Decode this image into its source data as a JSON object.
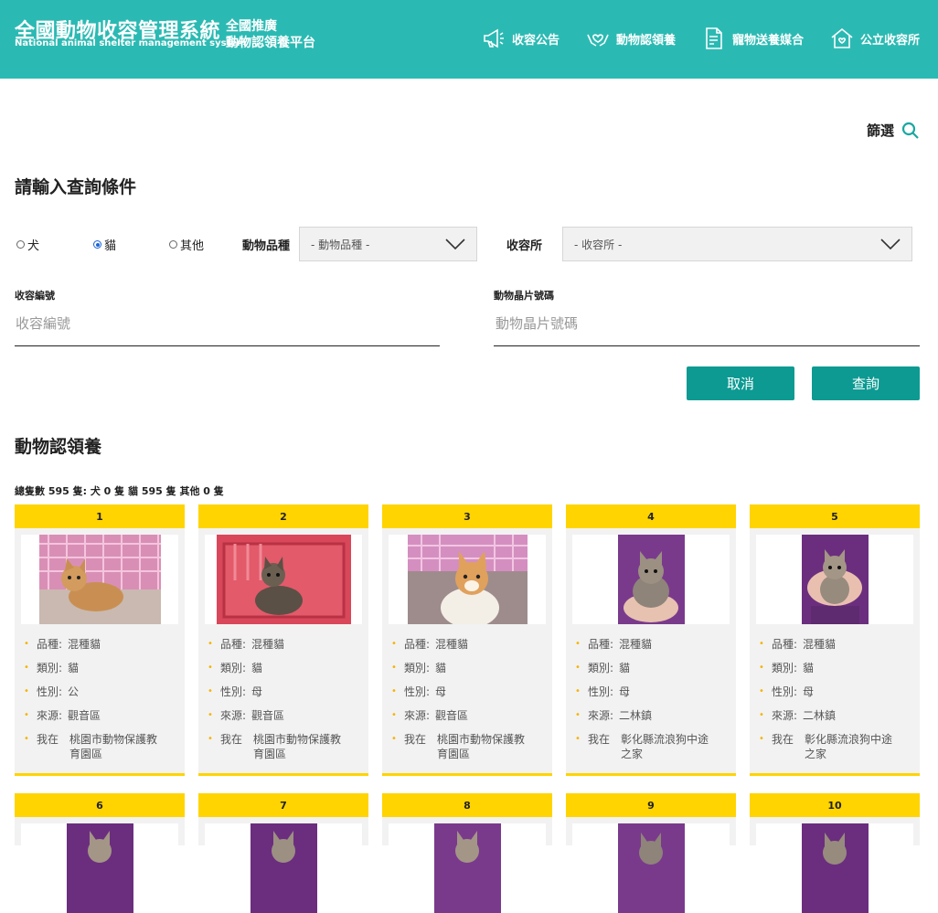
{
  "header": {
    "logo_main": "全國動物收容管理系統",
    "logo_sub": "National animal shelter management system",
    "logo_side_1": "全國推廣",
    "logo_side_2": "動物認領養平台",
    "nav": [
      {
        "label": "收容公告",
        "icon": "megaphone-icon"
      },
      {
        "label": "動物認領養",
        "icon": "hands-heart-icon"
      },
      {
        "label": "寵物送養媒合",
        "icon": "document-icon"
      },
      {
        "label": "公立收容所",
        "icon": "house-heart-icon"
      }
    ]
  },
  "filter": {
    "label": "篩選",
    "icon": "search-icon"
  },
  "query": {
    "title": "請輸入查詢條件",
    "radios": [
      {
        "label": "犬",
        "checked": false
      },
      {
        "label": "貓",
        "checked": true
      },
      {
        "label": "其他",
        "checked": false
      }
    ],
    "breed_label": "動物品種",
    "breed_value": "- 動物品種 -",
    "shelter_label": "收容所",
    "shelter_value": "- 收容所 -",
    "id_label": "收容編號",
    "id_placeholder": "收容編號",
    "chip_label": "動物晶片號碼",
    "chip_placeholder": "動物晶片號碼",
    "cancel": "取消",
    "search": "查詢"
  },
  "results": {
    "title": "動物認領養",
    "count_text": "總隻數 595 隻:   犬 0 隻 貓 595 隻 其他 0 隻",
    "key_breed": "品種:",
    "key_type": "類別:",
    "key_sex": "性別:",
    "key_source": "來源:",
    "key_at": "我在",
    "cards": [
      {
        "no": "1",
        "breed": "混種貓",
        "type": "貓",
        "sex": "公",
        "source": "觀音區",
        "at": "桃園市動物保護教育園區"
      },
      {
        "no": "2",
        "breed": "混種貓",
        "type": "貓",
        "sex": "母",
        "source": "觀音區",
        "at": "桃園市動物保護教育園區"
      },
      {
        "no": "3",
        "breed": "混種貓",
        "type": "貓",
        "sex": "母",
        "source": "觀音區",
        "at": "桃園市動物保護教育園區"
      },
      {
        "no": "4",
        "breed": "混種貓",
        "type": "貓",
        "sex": "母",
        "source": "二林鎮",
        "at": "彰化縣流浪狗中途之家"
      },
      {
        "no": "5",
        "breed": "混種貓",
        "type": "貓",
        "sex": "母",
        "source": "二林鎮",
        "at": "彰化縣流浪狗中途之家"
      },
      {
        "no": "6"
      },
      {
        "no": "7"
      },
      {
        "no": "8"
      },
      {
        "no": "9"
      },
      {
        "no": "10"
      }
    ]
  },
  "colors": {
    "brand": "#2bbab3",
    "button": "#0c9a92",
    "card_head": "#ffd400"
  }
}
